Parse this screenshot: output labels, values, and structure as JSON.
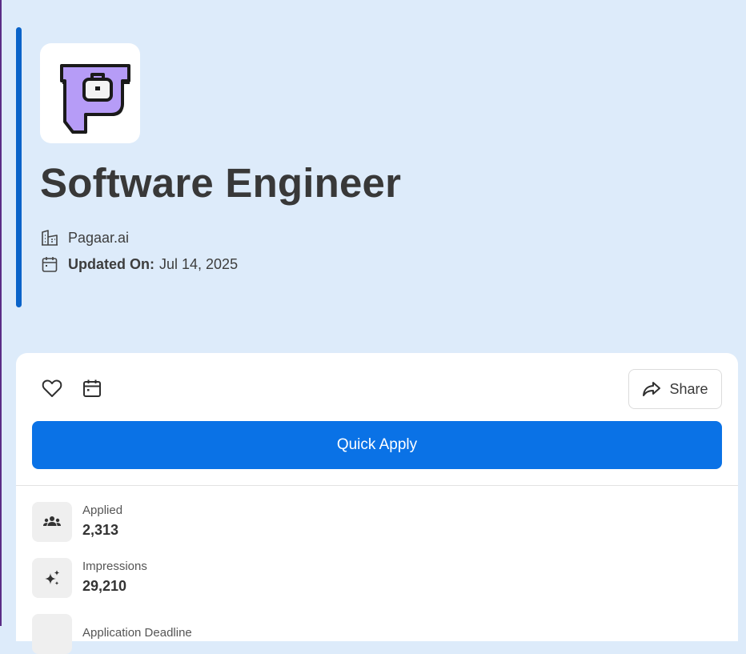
{
  "job": {
    "title": "Software Engineer",
    "company": "Pagaar.ai",
    "updated_label": "Updated On:",
    "updated_value": "Jul 14, 2025"
  },
  "actions": {
    "share_label": "Share",
    "apply_label": "Quick Apply"
  },
  "stats": [
    {
      "label": "Applied",
      "value": "2,313",
      "icon": "people-icon"
    },
    {
      "label": "Impressions",
      "value": "29,210",
      "icon": "sparkle-icon"
    },
    {
      "label": "Application Deadline",
      "value": "",
      "icon": "deadline-icon"
    }
  ],
  "colors": {
    "page_bg": "#ddebfa",
    "accent_bar": "#0a63c9",
    "primary_button": "#0a72e6",
    "logo_purple": "#b69cf7"
  }
}
